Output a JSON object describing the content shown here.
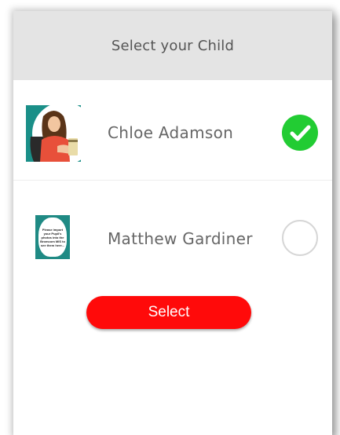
{
  "dialog": {
    "title": "Select your Child"
  },
  "children": [
    {
      "name": "Chloe Adamson",
      "selected": true,
      "avatar": "child-photo"
    },
    {
      "name": "Matthew Gardiner",
      "selected": false,
      "avatar": "photo-placeholder",
      "placeholder_text": "Please import your Pupil's photos into the Bromcom MIS to see them here..."
    }
  ],
  "actions": {
    "select_label": "Select"
  },
  "colors": {
    "header_bg": "#e4e4e4",
    "selected_check": "#22cc33",
    "button_red": "#ff0a0a",
    "placeholder_teal": "#1f8a84"
  },
  "icons": {
    "selected": "checkmark-circle-icon",
    "unselected": "empty-radio-icon"
  }
}
